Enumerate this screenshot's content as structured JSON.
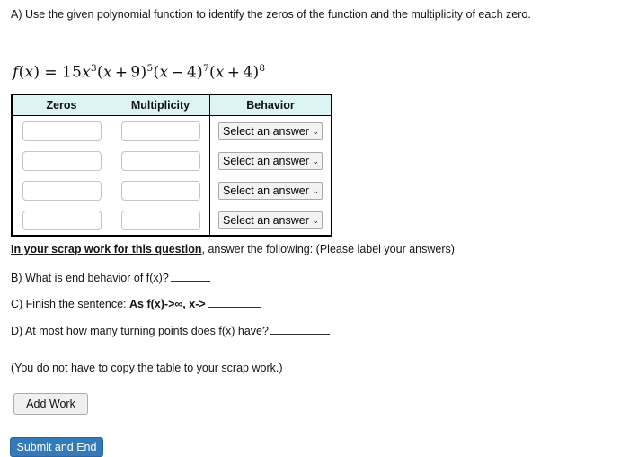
{
  "question": {
    "part_a_text": "A) Use the given polynomial function to identify the zeros of the function and the multiplicity of each zero.",
    "formula": {
      "plain": "f(x) = 15x^3(x + 9)^5(x - 4)^7(x + 4)^8",
      "lhs_f": "f",
      "lhs_open": "(",
      "lhs_var": "x",
      "lhs_close": ")",
      "equals": "=",
      "coefficient": "15",
      "base_var": "x",
      "exp0": "3",
      "f1_open": "(",
      "f1_var": "x",
      "f1_op": "+",
      "f1_num": "9",
      "f1_close": ")",
      "exp1": "5",
      "f2_open": "(",
      "f2_var": "x",
      "f2_op": "−",
      "f2_num": "4",
      "f2_close": ")",
      "exp2": "7",
      "f3_open": "(",
      "f3_var": "x",
      "f3_op": "+",
      "f3_num": "4",
      "f3_close": ")",
      "exp3": "8"
    }
  },
  "table": {
    "headers": [
      "Zeros",
      "Multiplicity",
      "Behavior"
    ],
    "rows": [
      {
        "zero": "",
        "multiplicity": "",
        "behavior": "Select an answer"
      },
      {
        "zero": "",
        "multiplicity": "",
        "behavior": "Select an answer"
      },
      {
        "zero": "",
        "multiplicity": "",
        "behavior": "Select an answer"
      },
      {
        "zero": "",
        "multiplicity": "",
        "behavior": "Select an answer"
      }
    ],
    "behavior_placeholder": "Select an answer",
    "chevron_glyph": "⌄",
    "input_placeholder": ""
  },
  "scrap": {
    "lead": "In your scrap work for this question",
    "rest": ", answer the following: (Please label your answers)"
  },
  "items": {
    "b": "B) What is end behavior of f(x)?",
    "c_prefix": "C) Finish the sentence:",
    "c_bold": "As f(x)->∞, x->",
    "d": "D) At most how many turning points does f(x) have?"
  },
  "note": "(You do not have to copy the table to your scrap work.)",
  "buttons": {
    "add_work": "Add Work",
    "submit_and_end": "Submit and End"
  },
  "colors": {
    "header_bg": "#ddf4f4",
    "submit_bg": "#337ab7",
    "table_border": "#000000"
  }
}
